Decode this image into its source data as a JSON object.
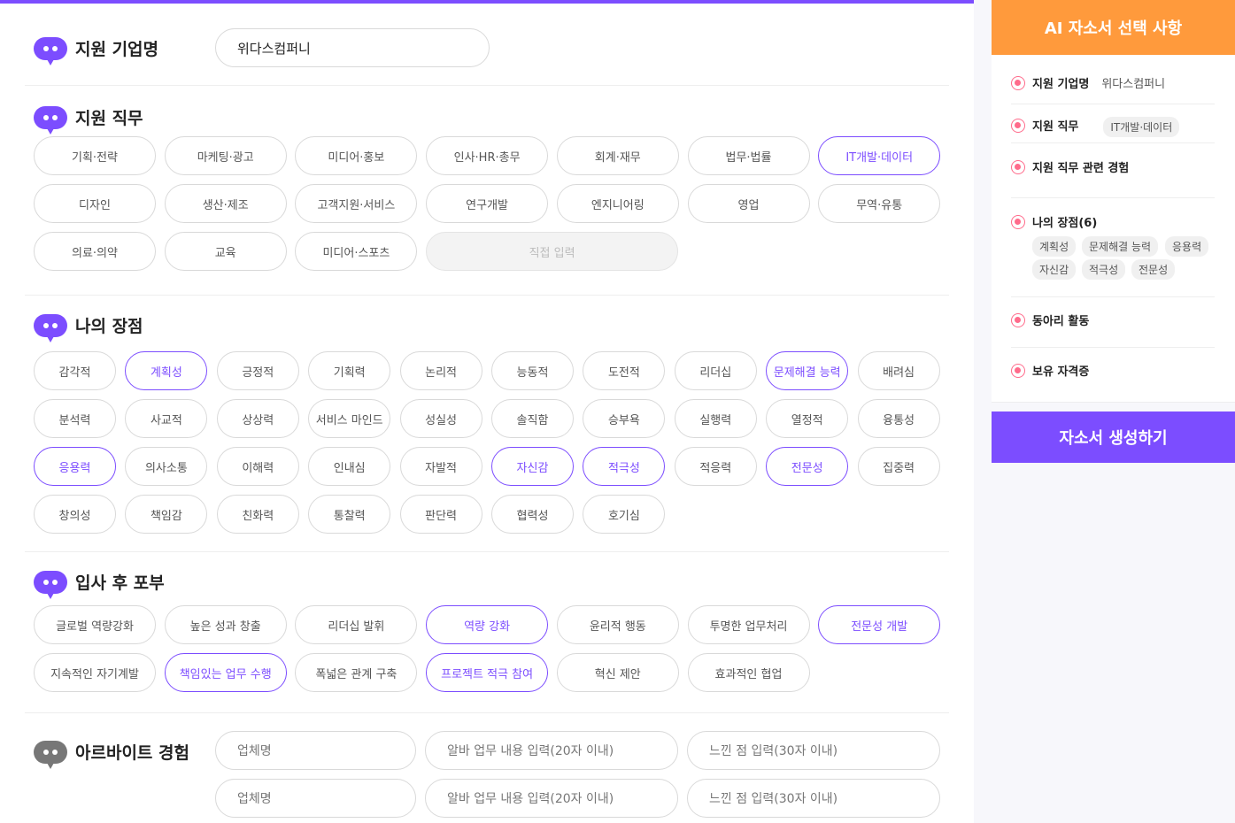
{
  "company": {
    "title": "지원 기업명",
    "value": "위다스컴퍼니"
  },
  "job": {
    "title": "지원 직무",
    "options": [
      "기획·전략",
      "마케팅·광고",
      "미디어·홍보",
      "인사·HR·총무",
      "회계·재무",
      "법무·법률",
      "IT개발·데이터",
      "디자인",
      "생산·제조",
      "고객지원·서비스",
      "연구개발",
      "엔지니어링",
      "영업",
      "무역·유통",
      "의료·의약",
      "교육",
      "미디어·스포츠"
    ],
    "selected": [
      "IT개발·데이터"
    ],
    "direct_placeholder": "직접 입력"
  },
  "strength": {
    "title": "나의 장점",
    "options": [
      "감각적",
      "계획성",
      "긍정적",
      "기획력",
      "논리적",
      "능동적",
      "도전적",
      "리더십",
      "문제해결 능력",
      "배려심",
      "분석력",
      "사교적",
      "상상력",
      "서비스 마인드",
      "성실성",
      "솔직함",
      "승부욕",
      "실행력",
      "열정적",
      "융통성",
      "응용력",
      "의사소통",
      "이해력",
      "인내심",
      "자발적",
      "자신감",
      "적극성",
      "적응력",
      "전문성",
      "집중력",
      "창의성",
      "책임감",
      "친화력",
      "통찰력",
      "판단력",
      "협력성",
      "호기심"
    ],
    "selected": [
      "계획성",
      "문제해결 능력",
      "응용력",
      "자신감",
      "적극성",
      "전문성"
    ]
  },
  "aspiration": {
    "title": "입사 후 포부",
    "options": [
      "글로벌 역량강화",
      "높은 성과 창출",
      "리더십 발휘",
      "역량 강화",
      "윤리적 행동",
      "투명한 업무처리",
      "전문성 개발",
      "지속적인 자기계발",
      "책임있는 업무 수행",
      "폭넓은 관계 구축",
      "프로젝트 적극 참여",
      "혁신 제안",
      "효과적인 협업"
    ],
    "selected": [
      "역량 강화",
      "전문성 개발",
      "책임있는 업무 수행",
      "프로젝트 적극 참여"
    ]
  },
  "parttime": {
    "title": "아르바이트 경험",
    "rows": [
      {
        "company": "업체명",
        "task": "알바 업무 내용 입력(20자 이내)",
        "feel": "느낀 점 입력(30자 이내)"
      },
      {
        "company": "업체명",
        "task": "알바 업무 내용 입력(20자 이내)",
        "feel": "느낀 점 입력(30자 이내)"
      }
    ]
  },
  "sidebar": {
    "title": "AI 자소서 선택 사항",
    "company_label": "지원 기업명",
    "company_value": "위다스컴퍼니",
    "job_label": "지원 직무",
    "job_value": "IT개발·데이터",
    "experience_label": "지원 직무 관련 경험",
    "strength_label": "나의 장점(6)",
    "strength_tags": [
      "계획성",
      "문제해결 능력",
      "응용력",
      "자신감",
      "적극성",
      "전문성"
    ],
    "club_label": "동아리 활동",
    "cert_label": "보유 자격증",
    "generate_button": "자소서 생성하기"
  },
  "colors": {
    "accent": "#7c4dff",
    "orange": "#ff9a3c",
    "dot": "#ff6b8b"
  }
}
